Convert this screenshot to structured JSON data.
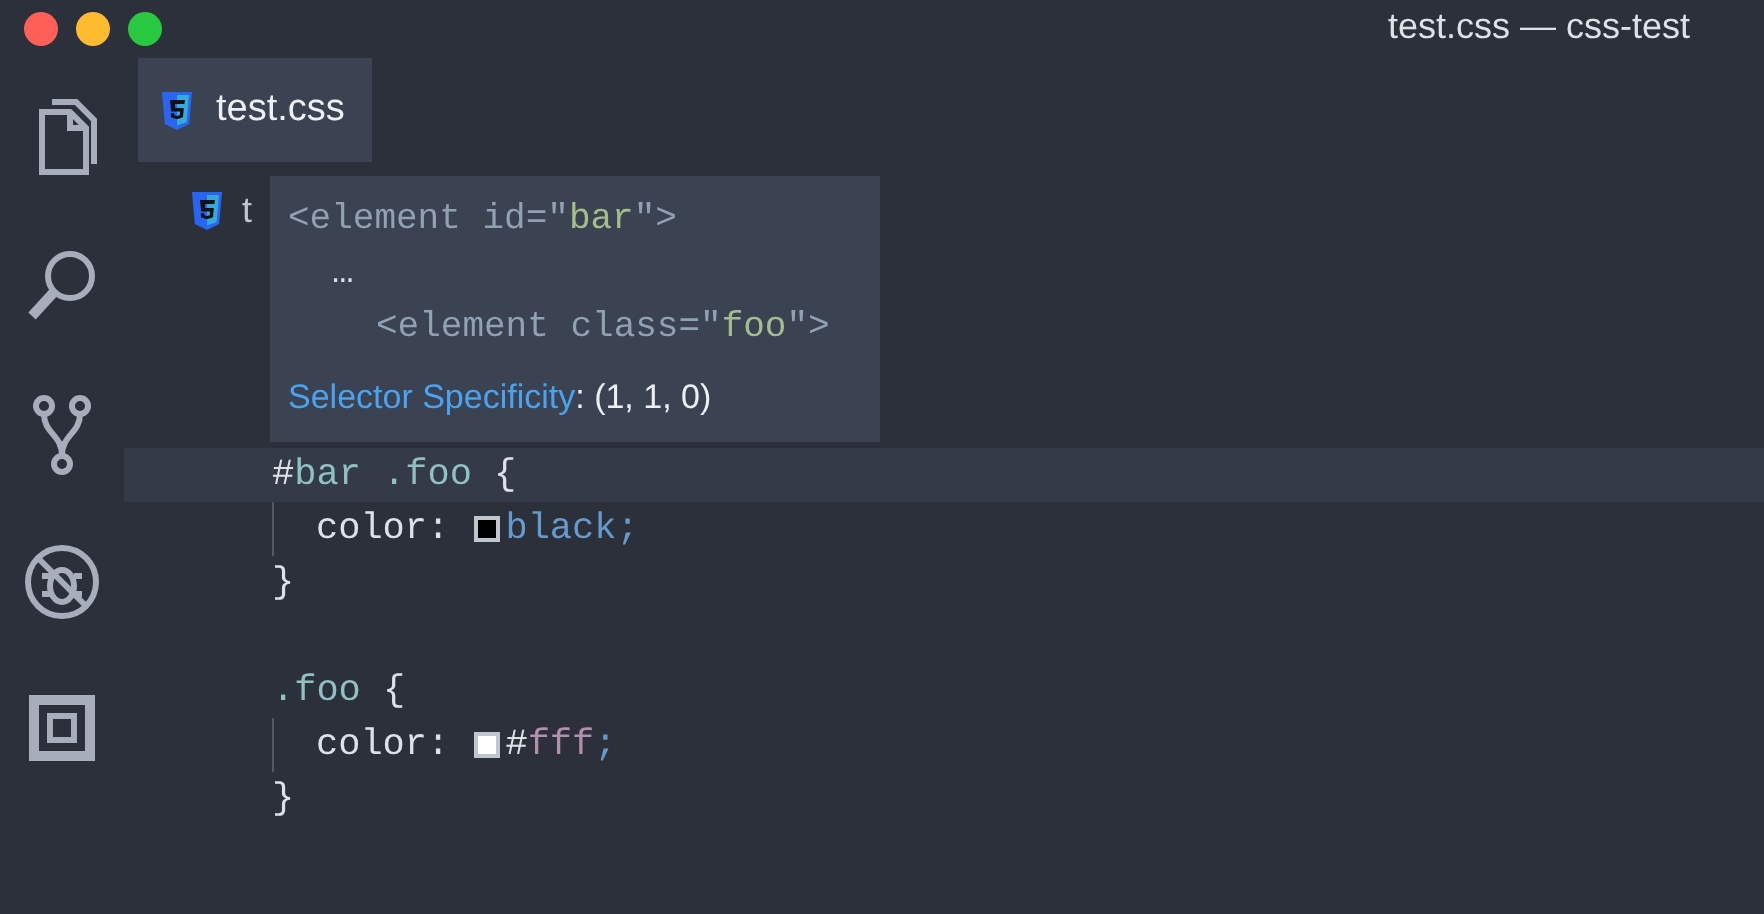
{
  "window": {
    "title": "test.css — css-test"
  },
  "activity_bar": [
    {
      "kind": "files",
      "selected": false
    },
    {
      "kind": "search",
      "selected": false
    },
    {
      "kind": "source-control",
      "selected": false
    },
    {
      "kind": "debug",
      "selected": false
    },
    {
      "kind": "extensions",
      "selected": false
    }
  ],
  "tabs": [
    {
      "label": "test.css",
      "selected": true
    }
  ],
  "breadcrumb": {
    "label": "t"
  },
  "hover": {
    "lines": [
      {
        "kind": "outer",
        "tokens": [
          {
            "text": "<element id=\"",
            "kind": "tag"
          },
          {
            "text": "bar",
            "kind": "string"
          },
          {
            "text": "\">",
            "kind": "tag"
          }
        ]
      },
      {
        "kind": "ellipsis",
        "tokens": [
          {
            "text": "…",
            "kind": "plain"
          }
        ]
      },
      {
        "kind": "inner",
        "tokens": [
          {
            "text": "<element class=\"",
            "kind": "tag"
          },
          {
            "text": "foo",
            "kind": "string"
          },
          {
            "text": "\">",
            "kind": "tag"
          }
        ]
      }
    ],
    "link": "Selector Specificity",
    "value": ": (1, 1, 0)"
  },
  "code": [
    {
      "highlighted": true,
      "kind": "rule",
      "tokens": [
        {
          "text": "#",
          "kind": "plain"
        },
        {
          "text": "bar .foo",
          "kind": "selector"
        },
        {
          "text": " {",
          "kind": "plain"
        }
      ]
    },
    {
      "highlighted": false,
      "kind": "declaration",
      "tokens": [
        {
          "text": "color: ",
          "kind": "plain"
        },
        {
          "kind": "swatch",
          "color": "#000000"
        },
        {
          "text": "black;",
          "kind": "keyword"
        }
      ]
    },
    {
      "highlighted": false,
      "kind": "rule",
      "tokens": [
        {
          "text": "}",
          "kind": "plain"
        }
      ]
    },
    {
      "highlighted": false,
      "kind": "blank"
    },
    {
      "highlighted": false,
      "kind": "rule",
      "tokens": [
        {
          "text": ".foo",
          "kind": "selector"
        },
        {
          "text": " {",
          "kind": "plain"
        }
      ]
    },
    {
      "highlighted": false,
      "kind": "declaration",
      "tokens": [
        {
          "text": "color: ",
          "kind": "plain"
        },
        {
          "kind": "swatch",
          "color": "#ffffff"
        },
        {
          "text": "#",
          "kind": "plain"
        },
        {
          "text": "fff",
          "kind": "hex"
        },
        {
          "text": ";",
          "kind": "keyword"
        }
      ]
    },
    {
      "highlighted": false,
      "kind": "rule",
      "tokens": [
        {
          "text": "}",
          "kind": "plain"
        }
      ]
    }
  ]
}
